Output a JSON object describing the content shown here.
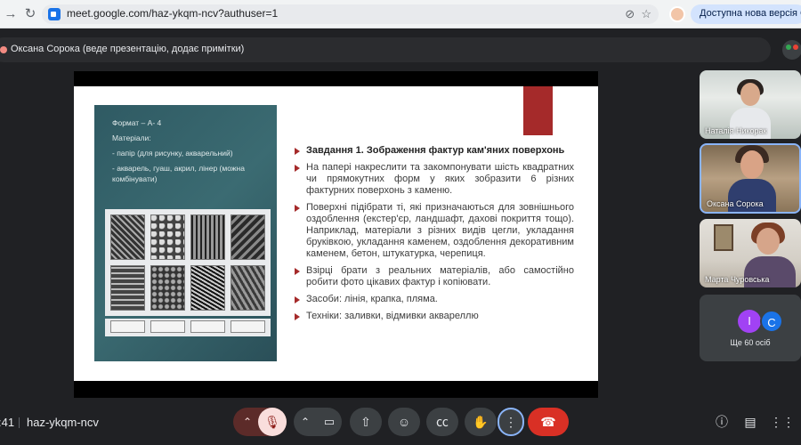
{
  "browser": {
    "url": "meet.google.com/haz-ykqm-ncv?authuser=1",
    "update_button": "Доступна нова версія Chrom",
    "icons": [
      "back-icon",
      "reload-icon",
      "site-icon",
      "hide-icon",
      "star-icon",
      "profile-avatar"
    ]
  },
  "presenter_bar": {
    "text": "Оксана Сорока (веде презентацію, додає примітки)"
  },
  "slide": {
    "left_panel": {
      "lines": [
        "Формат – А- 4",
        "Матеріали:",
        "- папір (для рисунку, акварельний)",
        "- акварель, гуаш, акрил, лінер (можна комбінувати)"
      ]
    },
    "bullets": [
      "Завдання 1. Зображення фактур кам'яних поверхонь",
      "На папері накреслити та закомпонувати шість квадратних чи прямокутних форм у яких зобразити 6 різних фактурних поверхонь з каменю.",
      "Поверхні підібрати ті, які призначаються для зовнішнього оздоблення (екстер'єр, ландшафт, дахові покриття тощо). Наприклад, матеріали з різних видів цегли, укладання бруківкою, укладання каменем, оздоблення декоративним каменем, бетон, штукатурка, черепиця.",
      "Взірці брати з реальних матеріалів, або самостійно робити фото цікавих фактур і копіювати.",
      "Засоби: лінія, крапка, пляма.",
      "Техніки: заливки, відмивки аквареллю"
    ]
  },
  "participants": [
    {
      "name": "Наталія Никорак"
    },
    {
      "name": "Оксана Сорока"
    },
    {
      "name": "Марта Чуровська"
    }
  ],
  "others": {
    "avatars": [
      "I",
      "C"
    ],
    "label": "Ще 60 осіб"
  },
  "bottom_bar": {
    "time": ":41",
    "meeting_code": "haz-ykqm-ncv"
  },
  "colors": {
    "accent_red": "#a52a2a",
    "hangup": "#d93025",
    "background": "#202124"
  }
}
